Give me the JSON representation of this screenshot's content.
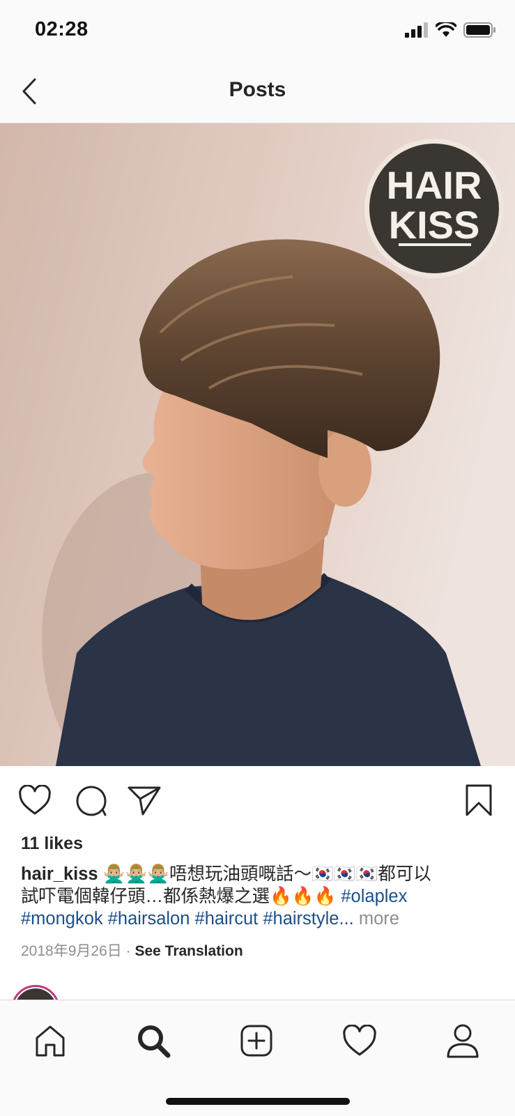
{
  "status": {
    "time": "02:28"
  },
  "nav": {
    "title": "Posts"
  },
  "photo": {
    "logo_line1": "HAIR",
    "logo_line2": "KISS"
  },
  "post": {
    "likes": "11 likes",
    "username": "hair_kiss",
    "caption_line1": "🙅🏼‍♂️🙅🏼‍♂️🙅🏼‍♂️唔想玩油頭嘅話～🇰🇷🇰🇷🇰🇷都可以",
    "caption_line2": "試吓電個韓仔頭…都係熱爆之選🔥🔥🔥",
    "hashtags": [
      "#olaplex",
      "#mongkok",
      "#hairsalon",
      "#haircut",
      "#hairstyle..."
    ],
    "more": "more",
    "date": "2018年9月26日",
    "separator": "·",
    "see_translation": "See Translation"
  },
  "icons": {
    "back": "chevron-left-icon",
    "like": "heart-icon",
    "comment": "comment-icon",
    "share": "paper-plane-icon",
    "save": "bookmark-icon",
    "tabs": [
      "home-icon",
      "search-icon",
      "add-post-icon",
      "activity-heart-icon",
      "profile-icon"
    ]
  },
  "colors": {
    "hashtag": "#1b4f8a",
    "secondary_text": "#8e8e8e",
    "story_ring": "#c13584"
  }
}
